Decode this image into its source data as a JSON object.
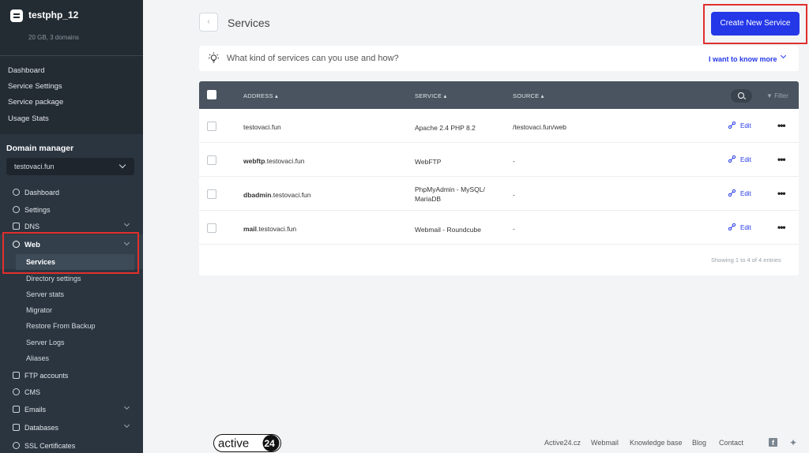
{
  "account": {
    "name": "testphp_12",
    "info": "20 GB, 3 domains"
  },
  "top_nav": [
    "Dashboard",
    "Service Settings",
    "Service package",
    "Usage Stats"
  ],
  "domain_manager": {
    "title": "Domain manager",
    "selected_domain": "testovaci.fun"
  },
  "nav": {
    "dashboard": "Dashboard",
    "settings": "Settings",
    "dns": "DNS",
    "web": "Web",
    "web_sub": [
      "Services",
      "Directory settings",
      "Server stats",
      "Migrator",
      "Restore From Backup",
      "Server Logs",
      "Aliases"
    ],
    "ftp": "FTP accounts",
    "cms": "CMS",
    "emails": "Emails",
    "databases": "Databases",
    "ssl": "SSL Certificates"
  },
  "header": {
    "back": "‹",
    "title": "Services",
    "create_button": "Create New Service"
  },
  "info_bar": {
    "text": "What kind of services can you use and how?",
    "link": "I want to know more"
  },
  "table": {
    "columns": {
      "address": "ADDRESS",
      "service": "SERVICE",
      "source": "SOURCE",
      "sort_marker": "▴",
      "filter": "Filter"
    },
    "rows": [
      {
        "addr_bold": "",
        "addr_rest": "testovaci.fun",
        "service1": "Apache 2.4 PHP 8.2",
        "service2": "",
        "source": "/testovaci.fun/web",
        "edit": "Edit",
        "more": "•••"
      },
      {
        "addr_bold": "webftp",
        "addr_rest": ".testovaci.fun",
        "service1": "WebFTP",
        "service2": "",
        "source": "-",
        "edit": "Edit",
        "more": "•••"
      },
      {
        "addr_bold": "dbadmin",
        "addr_rest": ".testovaci.fun",
        "service1": "PhpMyAdmin - MySQL/",
        "service2": "MariaDB",
        "source": "-",
        "edit": "Edit",
        "more": "•••"
      },
      {
        "addr_bold": "mail",
        "addr_rest": ".testovaci.fun",
        "service1": "Webmail - Roundcube",
        "service2": "",
        "source": "-",
        "edit": "Edit",
        "more": "•••"
      }
    ],
    "showing": "Showing 1 to 4 of 4 entries"
  },
  "footer": {
    "logo_text": "active",
    "logo_num": "24",
    "links": [
      "Active24.cz",
      "Webmail",
      "Knowledge base",
      "Blog",
      "Contact"
    ],
    "facebook": "f",
    "twitter": "🐦"
  },
  "colors": {
    "sidebar": "#2b3540",
    "accent": "#2438e8",
    "highlight": "#e0302c"
  }
}
